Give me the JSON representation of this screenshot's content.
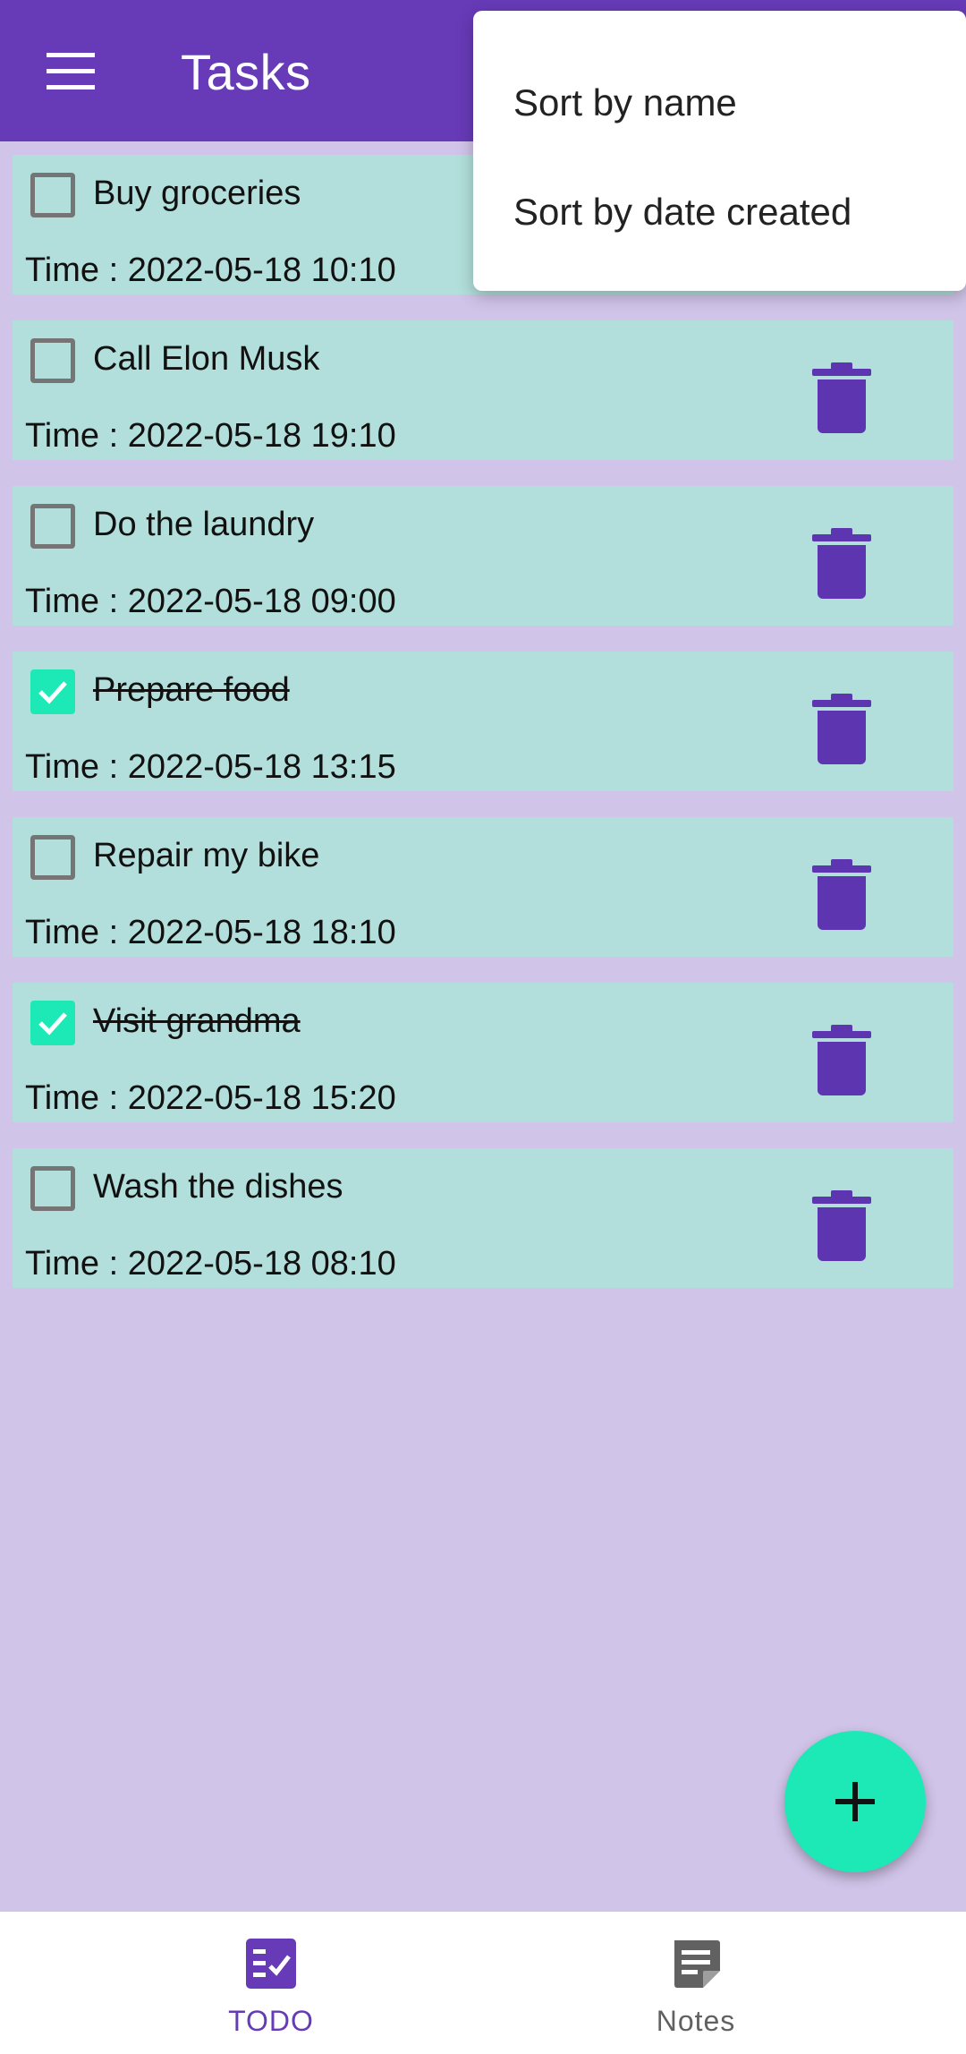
{
  "appbar": {
    "title": "Tasks",
    "menu_icon": "hamburger-menu-icon"
  },
  "sort_menu": {
    "items": [
      "Sort by name",
      "Sort by date created"
    ]
  },
  "tasks": [
    {
      "title": "Buy groceries",
      "time": "Time : 2022-05-18 10:10",
      "done": false
    },
    {
      "title": "Call Elon Musk",
      "time": "Time : 2022-05-18 19:10",
      "done": false
    },
    {
      "title": "Do the laundry",
      "time": "Time : 2022-05-18 09:00",
      "done": false
    },
    {
      "title": "Prepare food",
      "time": "Time : 2022-05-18 13:15",
      "done": true
    },
    {
      "title": "Repair my bike",
      "time": "Time : 2022-05-18 18:10",
      "done": false
    },
    {
      "title": "Visit grandma",
      "time": "Time : 2022-05-18 15:20",
      "done": true
    },
    {
      "title": "Wash the dishes",
      "time": "Time : 2022-05-18 08:10",
      "done": false
    }
  ],
  "fab": {
    "icon": "plus-icon"
  },
  "bottom_nav": {
    "items": [
      {
        "label": "TODO",
        "icon": "todo-checklist-icon",
        "active": true
      },
      {
        "label": "Notes",
        "icon": "notes-icon",
        "active": false
      }
    ]
  },
  "colors": {
    "primary": "#673AB7",
    "background": "#D1C4E9",
    "card": "#B2DFDB",
    "accent": "#1DE9B6",
    "delete_icon": "#5E35B1",
    "nav_active": "#673AB7",
    "nav_inactive": "#616161"
  }
}
